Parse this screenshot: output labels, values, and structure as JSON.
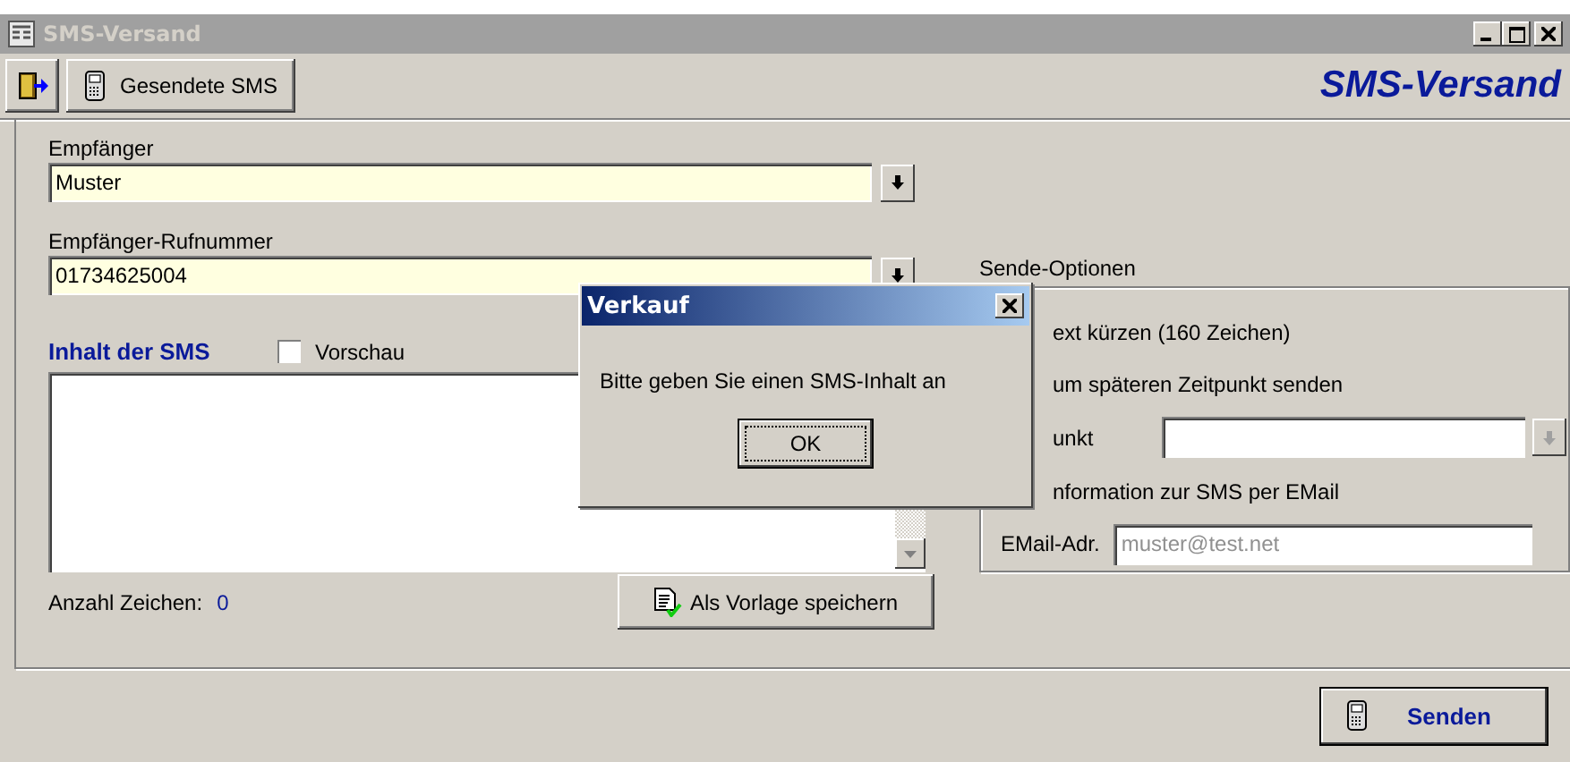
{
  "window": {
    "title": "SMS-Versand"
  },
  "toolbar": {
    "buttons": [
      {
        "kind": "exit"
      },
      {
        "kind": "sent",
        "label": "Gesendete SMS"
      }
    ],
    "heading": "SMS-Versand"
  },
  "recipient": {
    "label": "Empfänger",
    "value": "Muster"
  },
  "phone": {
    "label": "Empfänger-Rufnummer",
    "value": "01734625004"
  },
  "content": {
    "label": "Inhalt der SMS",
    "preview": {
      "label": "Vorschau",
      "checked": false
    }
  },
  "char_count": {
    "label": "Anzahl Zeichen:",
    "value": "0"
  },
  "save_template_button": "Als Vorlage speichern",
  "options": {
    "title": "Sende-Optionen",
    "items": [
      {
        "kind": "check",
        "label": "ext kürzen (160 Zeichen)"
      },
      {
        "kind": "check",
        "label": "um späteren Zeitpunkt senden"
      },
      {
        "kind": "combo",
        "label": "unkt",
        "disabled": true
      },
      {
        "kind": "check",
        "label": "nformation zur SMS per EMail"
      },
      {
        "kind": "field",
        "label": "EMail-Adr.",
        "placeholder": "muster@test.net"
      }
    ]
  },
  "send_button": "Senden",
  "dialog": {
    "title": "Verkauf",
    "message": "Bitte geben Sie einen SMS-Inhalt an",
    "button": "OK"
  }
}
